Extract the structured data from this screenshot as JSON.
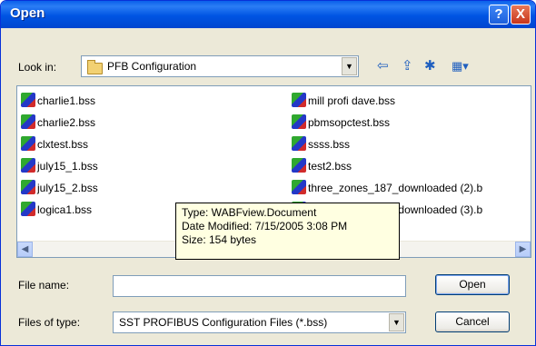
{
  "window": {
    "title": "Open",
    "help_label": "?",
    "close_label": "X"
  },
  "lookin": {
    "label": "Look in:",
    "value": "PFB Configuration"
  },
  "files": [
    {
      "name": "charlie1.bss"
    },
    {
      "name": "charlie2.bss"
    },
    {
      "name": "clxtest.bss"
    },
    {
      "name": "july15_1.bss"
    },
    {
      "name": "july15_2.bss"
    },
    {
      "name": "logica1.bss"
    },
    {
      "name": "mill profi dave.bss"
    },
    {
      "name": "pbmsopctest.bss"
    },
    {
      "name": "ssss.bss"
    },
    {
      "name": "test2.bss"
    },
    {
      "name": "three_zones_187_downloaded (2).b"
    },
    {
      "name": "three_zones_187_downloaded (3).b"
    }
  ],
  "tooltip": {
    "type": "Type: WABFview.Document",
    "modified": "Date Modified: 7/15/2005 3:08 PM",
    "size": "Size: 154 bytes"
  },
  "filename": {
    "label": "File name:",
    "value": ""
  },
  "filetype": {
    "label": "Files of type:",
    "value": "SST PROFIBUS Configuration Files (*.bss)"
  },
  "buttons": {
    "open": "Open",
    "cancel": "Cancel"
  }
}
